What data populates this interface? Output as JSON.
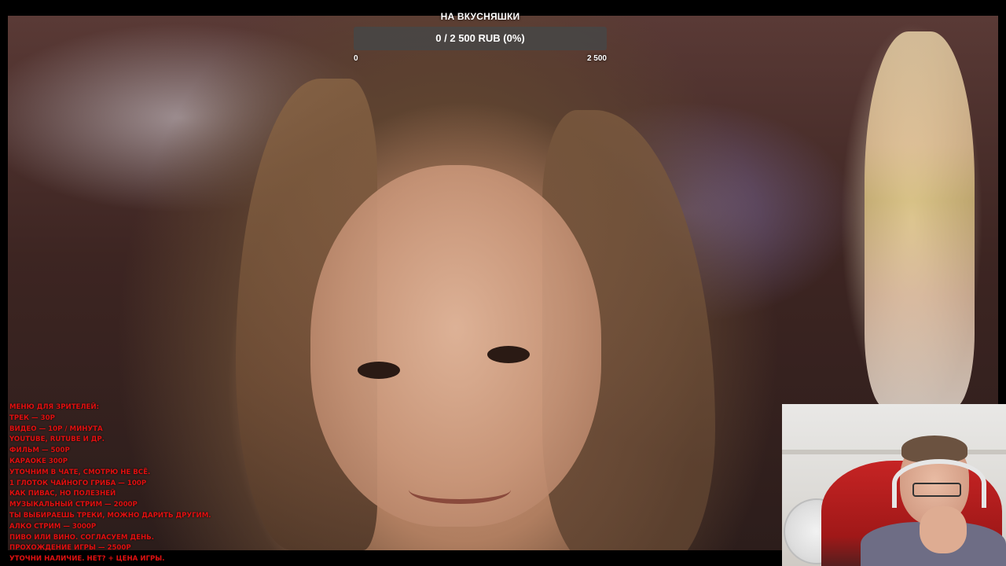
{
  "goal": {
    "title": "НА ВКУСНЯШКИ",
    "amount_text": "0 / 2 500 RUB (0%)",
    "progress_percent": 0,
    "min_label": "0",
    "max_label": "2 500"
  },
  "menu": {
    "lines": [
      "МЕНЮ ДЛЯ ЗРИТЕЛЕЙ:",
      " ТРЕК — 30Р",
      "ВИДЕО — 10Р / МИНУТА",
      "YOUTUBE, RUTUBE И ДР.",
      " ФИЛЬМ — 500Р",
      "КАРАОКЕ 300Р",
      "УТОЧНИМ В ЧАТЕ, СМОТРЮ НЕ ВСЁ.",
      " 1 ГЛОТОК ЧАЙНОГО ГРИБА — 100Р",
      "КАК ПИВАС, НО ПОЛЕЗНЕЙ",
      "МУЗЫКАЛЬНЫЙ СТРИМ — 2000Р",
      "ТЫ ВЫБИРАЕШЬ ТРЕКИ, МОЖНО ДАРИТЬ ДРУГИМ.",
      " АЛКО СТРИМ — 3000Р",
      "ПИВО ИЛИ ВИНО. СОГЛАСУЕМ ДЕНЬ.",
      " ПРОХОЖДЕНИЕ ИГРЫ — 2500Р",
      "УТОЧНИ НАЛИЧИЕ. НЕТ? + ЦЕНА ИГРЫ."
    ]
  },
  "colors": {
    "menu_text": "#e01010",
    "goal_bar_bg": "#464646",
    "page_bg": "#000000"
  }
}
